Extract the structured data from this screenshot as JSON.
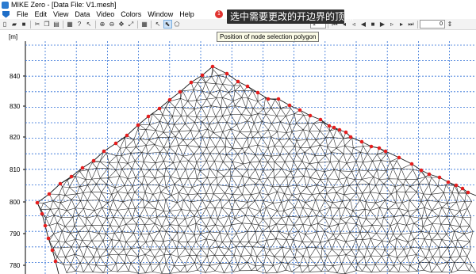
{
  "window": {
    "title": "MIKE Zero - [Data File: V1.mesh]"
  },
  "menu": [
    "File",
    "Edit",
    "View",
    "Data",
    "Video",
    "Colors",
    "Window",
    "Help"
  ],
  "toolbar": {
    "field_value": "1",
    "frame_value": "0"
  },
  "callout": {
    "badge": "1",
    "text": "选中需要更改的开边界的顶点"
  },
  "tooltip": "Position of node selection polygon",
  "plot": {
    "units": "[m]",
    "y_ticks": [
      "840",
      "830",
      "820",
      "810",
      "800",
      "790",
      "780"
    ],
    "grid_color": "#2f6fd6",
    "mesh_color": "#1a1a1a",
    "node_color": "#e61e1e"
  },
  "icons": [
    "new-icon",
    "open-icon",
    "save-icon",
    "cut-icon",
    "copy-icon",
    "paste-icon",
    "print-icon",
    "help-icon",
    "context-help-icon",
    "zoom-in-icon",
    "zoom-out-icon",
    "pan-icon",
    "zoom-extent-icon",
    "grid-icon",
    "select-icon",
    "select-node-icon",
    "polygon-select-icon",
    "first-frame-icon",
    "prev-icon",
    "step-back-icon",
    "play-back-icon",
    "stop-icon",
    "play-icon",
    "step-forward-icon",
    "next-icon",
    "last-frame-icon"
  ]
}
